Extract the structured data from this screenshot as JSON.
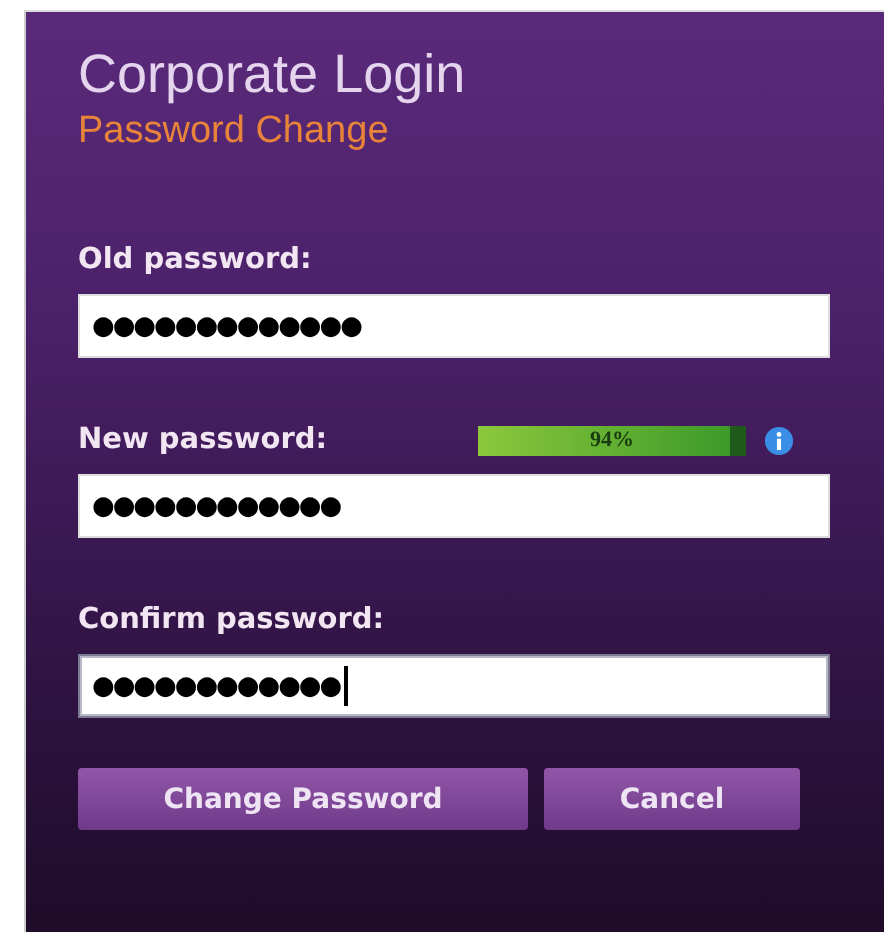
{
  "title": "Corporate Login",
  "subtitle": "Password Change",
  "fields": [
    {
      "label": "Old password:",
      "value": "●●●●●●●●●●●●●",
      "focused": false
    },
    {
      "label": "New password:",
      "value": "●●●●●●●●●●●●",
      "focused": false,
      "strength": {
        "level": 0.94,
        "reading": "94%"
      }
    },
    {
      "label": "Confirm password:",
      "value": "●●●●●●●●●●●●",
      "focused": true
    }
  ],
  "buttons": [
    {
      "label": "Change Password",
      "kind": "primary"
    },
    {
      "label": "Cancel",
      "kind": "secondary"
    }
  ]
}
